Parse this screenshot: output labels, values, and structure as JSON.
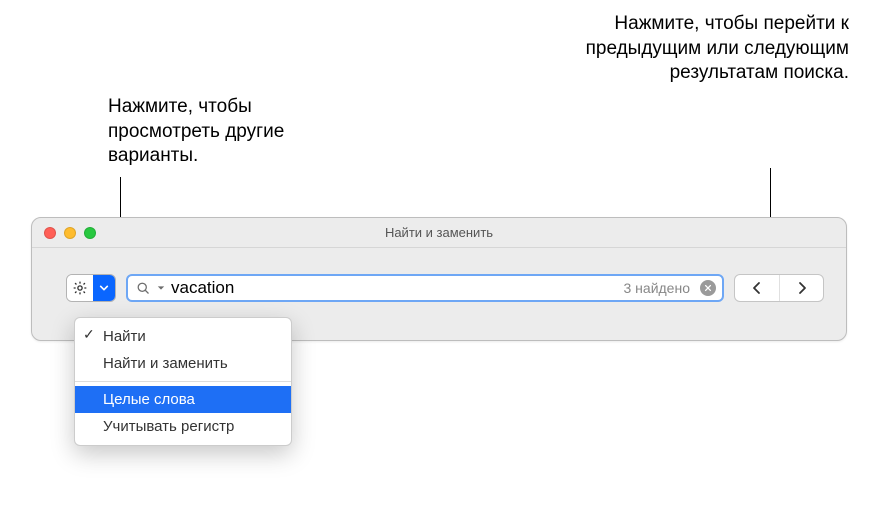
{
  "callouts": {
    "options": "Нажмите, чтобы просмотреть другие варианты.",
    "nav": "Нажмите, чтобы перейти к предыдущим или следующим результатам поиска."
  },
  "panel": {
    "title": "Найти и заменить"
  },
  "search": {
    "value": "vacation",
    "results_label": "3 найдено"
  },
  "menu": {
    "find": "Найти",
    "find_replace": "Найти и заменить",
    "whole_words": "Целые слова",
    "match_case": "Учитывать регистр"
  }
}
